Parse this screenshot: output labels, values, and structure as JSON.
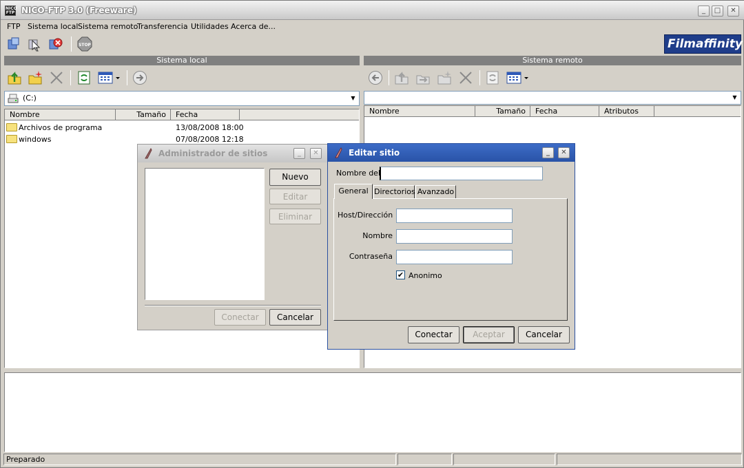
{
  "window": {
    "title": "NICO-FTP 3.0  (Freeware)",
    "icon_text": "NICO FTP"
  },
  "menu": [
    {
      "label": "FTP"
    },
    {
      "label": "Sistema local"
    },
    {
      "label": "Sistema remoto"
    },
    {
      "label": "Transferencia"
    },
    {
      "label": "Utilidades"
    },
    {
      "label": "Acerca de..."
    }
  ],
  "logo": "Filmaffinity",
  "stop_label": "STOP",
  "local": {
    "header": "Sistema local",
    "drive": "(C:)",
    "columns": [
      "Nombre",
      "Tamaño",
      "Fecha"
    ],
    "files": [
      {
        "name": "Archivos de programa",
        "size": "",
        "date": "13/08/2008 18:00"
      },
      {
        "name": "windows",
        "size": "",
        "date": "07/08/2008 12:18"
      }
    ]
  },
  "remote": {
    "header": "Sistema remoto",
    "path": "",
    "columns": [
      "Nombre",
      "Tamaño",
      "Fecha",
      "Atributos"
    ]
  },
  "status": {
    "text": "Preparado"
  },
  "site_manager": {
    "title": "Administrador de sitios",
    "new_label": "Nuevo",
    "edit_label": "Editar",
    "delete_label": "Eliminar",
    "connect_label": "Conectar",
    "cancel_label": "Cancelar"
  },
  "edit_site": {
    "title": "Editar sitio",
    "site_name_label": "Nombre del s",
    "site_name_value": "",
    "tabs": [
      "General",
      "Directorios",
      "Avanzado"
    ],
    "host_label": "Host/Dirección",
    "host_value": "",
    "user_label": "Nombre",
    "user_value": "",
    "password_label": "Contraseña",
    "password_value": "",
    "anon_label": "Anonimo",
    "anon_checked": true,
    "connect_label": "Conectar",
    "accept_label": "Aceptar",
    "cancel_label": "Cancelar"
  }
}
